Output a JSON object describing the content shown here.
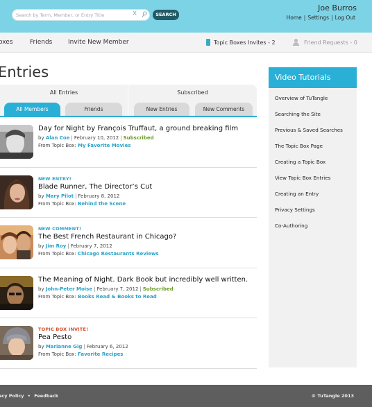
{
  "header": {
    "search_placeholder": "Search by Term, Member, or Entry Title",
    "search_button": "SEARCH",
    "clear_glyph": "X",
    "username": "Joe Burros",
    "links": [
      "Home",
      "Settings",
      "Log Out"
    ],
    "link_separator": "|"
  },
  "nav": {
    "items": [
      "oxes",
      "Friends",
      "Invite New Member"
    ],
    "invites": "Topic Boxes Invites - 2",
    "requests": "Friend Requests - 0",
    "icons": [
      "topic-box-icon",
      "person-icon"
    ]
  },
  "page": {
    "title": "Entries"
  },
  "tabs": {
    "groups": [
      "All Entries",
      "Subscribed"
    ],
    "subtabs": [
      "All Members",
      "Friends",
      "New Entries",
      "New Comments"
    ],
    "active_subtab": "All Members"
  },
  "entries": [
    {
      "flag": "",
      "title": "Day for Night by François Truffaut, a ground breaking film",
      "by": "by",
      "author": "Alan Coe",
      "date": "February 10, 2012",
      "subscribed": "Subscribed",
      "from_label": "From Topic Box:",
      "box": "My Favorite Movies"
    },
    {
      "flag": "NEW ENTRY!",
      "title": "Blade Runner, The Director’s Cut",
      "by": "by",
      "author": "Mary Pilot",
      "date": "February 8, 2012",
      "subscribed": "",
      "from_label": "From Topic Box:",
      "box": "Behind the Scene"
    },
    {
      "flag": "NEW COMMENT!",
      "title": "The Best French Restaurant in Chicago?",
      "by": "by",
      "author": "Jim Roy",
      "date": "February 7, 2012",
      "subscribed": "",
      "from_label": "From Topic Box:",
      "box": "Chicago Restaurants Reviews"
    },
    {
      "flag": "",
      "title": "The Meaning of Night. Dark Book but incredibly well written.",
      "by": "by",
      "author": "John-Peter Moise",
      "date": "February 7, 2012",
      "subscribed": "Subscribed",
      "from_label": "From Topic Box:",
      "box": "Books Read & Books to Read"
    },
    {
      "flag": "TOPIC BOX INVITE!",
      "title": "Pea Pesto",
      "by": "by",
      "author": "Marianne Gig",
      "date": "February 6, 2012",
      "subscribed": "",
      "from_label": "From Topic Box:",
      "box": "Favorite Recipes"
    }
  ],
  "sidebar": {
    "title": "Video Tutorials",
    "items": [
      "Overview of TuTangle",
      "Searching the Site",
      "Previous & Saved Searches",
      "The Topic Box Page",
      "Creating a Topic Box",
      "View Topic Box Entries",
      "Creating an Entry",
      "Privacy Settings",
      "Co-Authoring"
    ]
  },
  "footer": {
    "privacy": "acy Policy",
    "dot": "•",
    "feedback": "Feedback",
    "copyright": "© TuTangle 2013"
  },
  "colors": {
    "topbar": "#7dd3e6",
    "accent": "#2ab0d6",
    "invite_flag": "#d84d2b",
    "subscribed": "#6a9a20",
    "footer": "#5e5e5e"
  }
}
